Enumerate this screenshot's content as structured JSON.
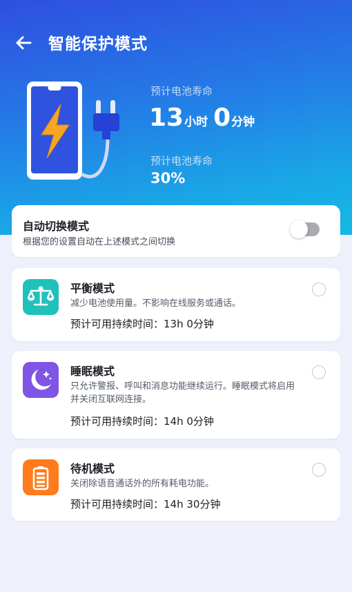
{
  "header": {
    "title": "智能保护模式",
    "back_icon": "back-arrow-icon"
  },
  "battery": {
    "life_label": "预计电池寿命",
    "hours": "13",
    "hours_unit": "小时",
    "minutes": "0",
    "minutes_unit": "分钟",
    "level_label": "预计电池寿命",
    "level_value": "30%",
    "illustration_icons": [
      "phone-charging-icon",
      "lightning-bolt-icon",
      "power-plug-icon"
    ]
  },
  "auto_switch": {
    "title": "自动切换模式",
    "description": "根据您的设置自动在上述模式之间切换",
    "enabled": false
  },
  "modes": [
    {
      "title": "平衡模式",
      "description": "减少电池使用量。不影响在线服务或通话。",
      "duration": "预计可用持续时间：13h 0分钟",
      "icon": "balance-scale-icon",
      "icon_color": "#1fc2bb",
      "selected": false
    },
    {
      "title": "睡眠模式",
      "description": "只允许警报、呼叫和消息功能继续运行。睡眠模式将启用并关闭互联网连接。",
      "duration": "预计可用持续时间：14h 0分钟",
      "icon": "moon-icon",
      "icon_color": "#7f55e6",
      "selected": false
    },
    {
      "title": "待机模式",
      "description": "关闭除语音通话外的所有耗电功能。",
      "duration": "预计可用持续时间：14h 30分钟",
      "icon": "battery-icon",
      "icon_color": "#ff7b1c",
      "selected": false
    }
  ],
  "colors": {
    "header_gradient_start": "#2f4fe0",
    "header_gradient_end": "#16b9e4",
    "page_background": "#eef0fb",
    "bolt": "#f7a623",
    "plug": "#2541d6"
  }
}
